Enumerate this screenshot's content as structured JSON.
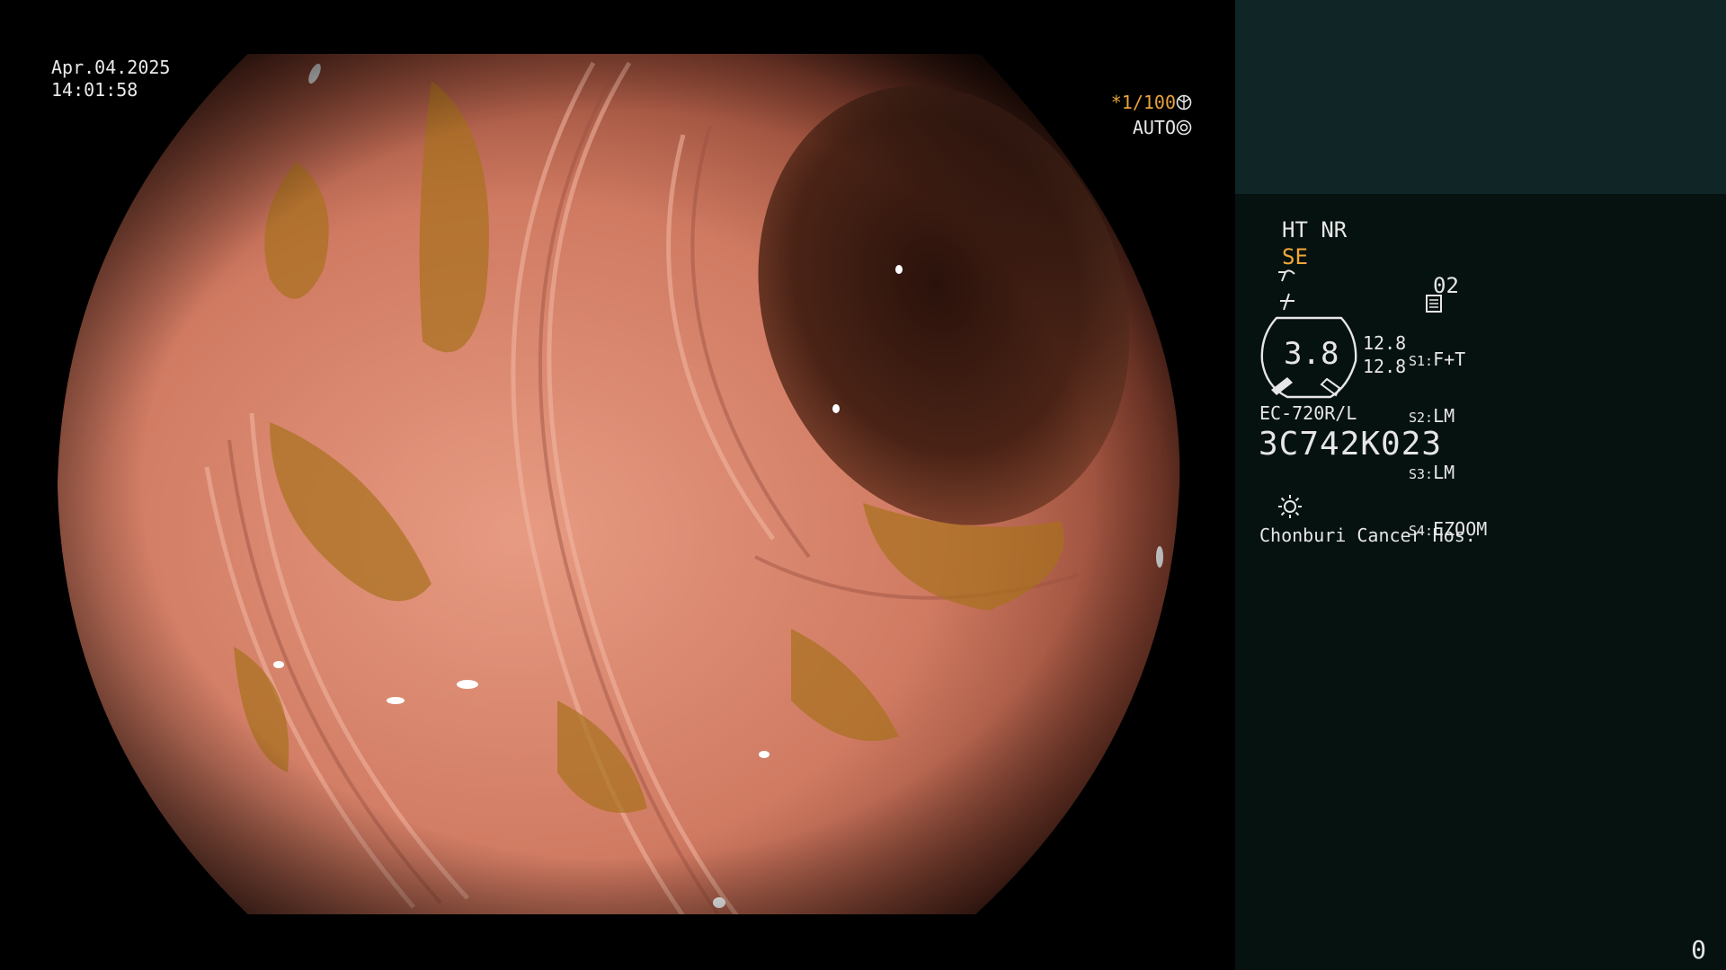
{
  "image": {
    "date": "Apr.04.2025",
    "time": "14:01:58",
    "shutter": "*1/100",
    "iris": "AUTO"
  },
  "panel": {
    "ht_nr": "HT NR",
    "se_label": "SE",
    "memory_label": "02",
    "zoom_value": "3.8",
    "values": [
      "12.8",
      "12.8"
    ],
    "switches": [
      {
        "key": "S1:",
        "value": "F+T"
      },
      {
        "key": "S2:",
        "value": "LM"
      },
      {
        "key": "S3:",
        "value": "LM"
      },
      {
        "key": "S4:",
        "value": "EZOOM"
      }
    ],
    "scope_model": "EC-720R/L",
    "scope_serial": "3C742K023",
    "hospital": "Chonburi Cancer Hos.",
    "counter": "0"
  },
  "colors": {
    "panel_top": "#0f2526",
    "panel": "#061210",
    "accent_orange": "#f0a838"
  },
  "icons": [
    "shutter-icon",
    "iris-icon",
    "se-icon",
    "enhance-icon",
    "memory-icon",
    "zoom-ring-icon",
    "light-icon"
  ]
}
